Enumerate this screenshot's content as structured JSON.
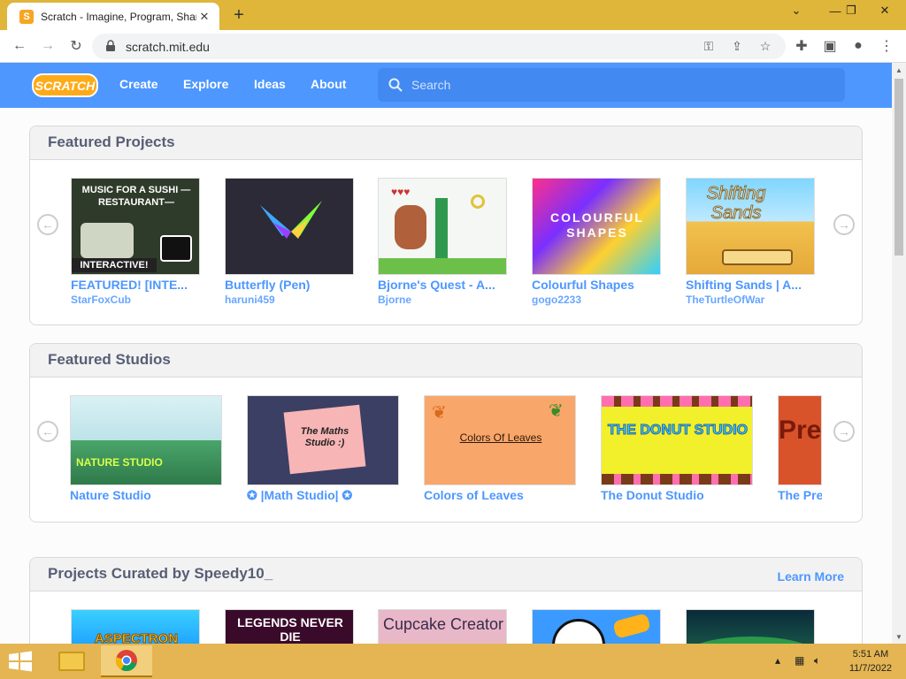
{
  "browser": {
    "tab_title": "Scratch - Imagine, Program, Share",
    "favicon_letter": "S",
    "url": "scratch.mit.edu"
  },
  "nav": {
    "logo": "SCRATCH",
    "links": [
      "Create",
      "Explore",
      "Ideas",
      "About"
    ],
    "search_placeholder": "Search"
  },
  "featured_projects": {
    "title": "Featured Projects",
    "items": [
      {
        "title": "FEATURED! [INTE...",
        "author": "StarFoxCub",
        "thumb_text": "MUSIC FOR A SUSHI —RESTAURANT—",
        "thumb_badge": "INTERACTIVE!"
      },
      {
        "title": "Butterfly (Pen)",
        "author": "haruni459"
      },
      {
        "title": "Bjorne's Quest - A...",
        "author": "Bjorne"
      },
      {
        "title": "Colourful Shapes",
        "author": "gogo2233",
        "thumb_text": "COLOURFUL SHAPES"
      },
      {
        "title": "Shifting Sands | A...",
        "author": "TheTurtleOfWar",
        "thumb_text": "Shifting Sands"
      }
    ]
  },
  "featured_studios": {
    "title": "Featured Studios",
    "items": [
      {
        "title": "Nature Studio",
        "thumb_text": "NATURE STUDIO"
      },
      {
        "title": "✪ |Math Studio| ✪",
        "thumb_text": "The Maths Studio :)"
      },
      {
        "title": "Colors of Leaves",
        "thumb_text": "Colors Of Leaves"
      },
      {
        "title": "The Donut Studio",
        "thumb_text": "THE DONUT STUDIO"
      },
      {
        "title": "The Pre",
        "thumb_text": "Pre"
      }
    ]
  },
  "curated": {
    "title": "Projects Curated by Speedy10_",
    "learn_more": "Learn More",
    "items": [
      {
        "thumb_text": "ASPECTRON"
      },
      {
        "thumb_text": "LEGENDS NEVER DIE"
      },
      {
        "thumb_text": "Cupcake Creator"
      },
      {
        "thumb_text": ""
      },
      {
        "thumb_text": ""
      }
    ]
  },
  "taskbar": {
    "time": "5:51 AM",
    "date": "11/7/2022"
  },
  "colors": {
    "scratch_blue": "#4d97ff",
    "title_gray": "#575e75",
    "chrome_tab_bar": "#dfb53a"
  }
}
